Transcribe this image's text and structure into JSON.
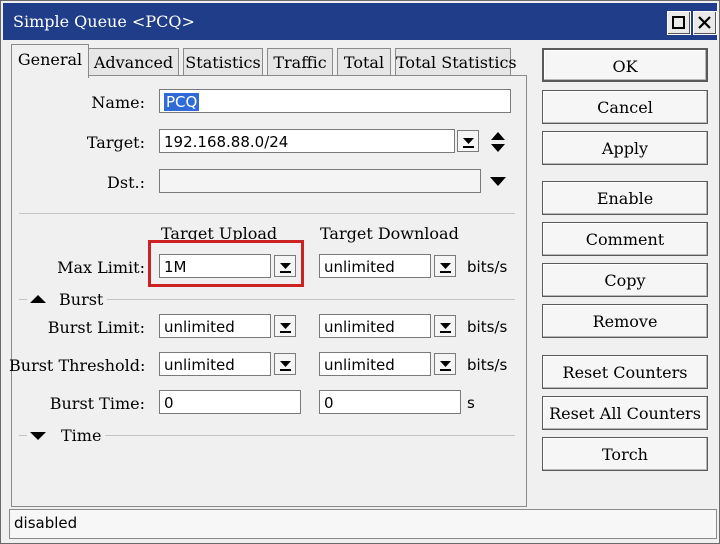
{
  "window": {
    "title": "Simple Queue <PCQ>"
  },
  "tabs": [
    "General",
    "Advanced",
    "Statistics",
    "Traffic",
    "Total",
    "Total Statistics"
  ],
  "form": {
    "name_label": "Name:",
    "name_value": "PCQ",
    "target_label": "Target:",
    "target_value": "192.168.88.0/24",
    "dst_label": "Dst.:",
    "dst_value": "",
    "col_upload": "Target Upload",
    "col_download": "Target Download",
    "max_limit_label": "Max Limit:",
    "max_limit_upload": "1M",
    "max_limit_download": "unlimited",
    "max_limit_unit": "bits/s",
    "burst_group": "Burst",
    "burst_limit_label": "Burst Limit:",
    "burst_limit_upload": "unlimited",
    "burst_limit_download": "unlimited",
    "burst_limit_unit": "bits/s",
    "burst_threshold_label": "Burst Threshold:",
    "burst_threshold_upload": "unlimited",
    "burst_threshold_download": "unlimited",
    "burst_threshold_unit": "bits/s",
    "burst_time_label": "Burst Time:",
    "burst_time_upload": "0",
    "burst_time_download": "0",
    "burst_time_unit": "s",
    "time_group": "Time"
  },
  "buttons": {
    "ok": "OK",
    "cancel": "Cancel",
    "apply": "Apply",
    "enable": "Enable",
    "comment": "Comment",
    "copy": "Copy",
    "remove": "Remove",
    "reset_counters": "Reset Counters",
    "reset_all_counters": "Reset All Counters",
    "torch": "Torch"
  },
  "status": {
    "text": "disabled"
  },
  "colors": {
    "titlebar": "#1f3d88",
    "highlight": "#cc2222",
    "selection": "#2f6ad6"
  }
}
